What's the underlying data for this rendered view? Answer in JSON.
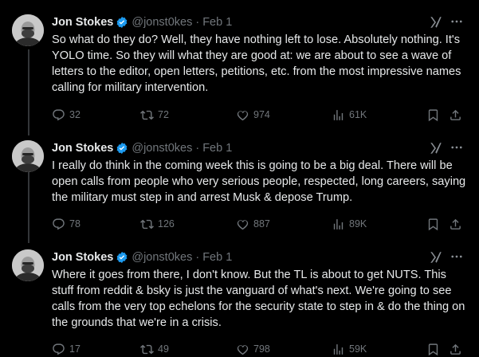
{
  "tweets": [
    {
      "author_name": "Jon Stokes",
      "handle": "@jonst0kes",
      "date": "Feb 1",
      "text": "So what do they do? Well, they have nothing left to lose. Absolutely nothing. It's YOLO time. So they will what they are good at: we are about to see a wave of letters to the editor, open letters, petitions, etc. from the most impressive names calling for military intervention.",
      "replies": "32",
      "reposts": "72",
      "likes": "974",
      "views": "61K"
    },
    {
      "author_name": "Jon Stokes",
      "handle": "@jonst0kes",
      "date": "Feb 1",
      "text": "I really do think in the coming week this is going to be a big deal. There will be open calls from people who very serious people, respected, long careers, saying the military must step in and arrest Musk & depose Trump.",
      "replies": "78",
      "reposts": "126",
      "likes": "887",
      "views": "89K"
    },
    {
      "author_name": "Jon Stokes",
      "handle": "@jonst0kes",
      "date": "Feb 1",
      "text": "Where it goes from there, I don't know. But the TL is about to get NUTS. This stuff from reddit & bsky is just the vanguard of what's next. We're going to see calls from the very top echelons for the security state to step in & do the thing on the grounds that we're in a crisis.",
      "replies": "17",
      "reposts": "49",
      "likes": "798",
      "views": "59K"
    }
  ],
  "separator": "·",
  "icons": {
    "verified": "verified-badge-icon",
    "grok": "grok-icon",
    "more": "more-dots-icon",
    "reply": "reply-icon",
    "repost": "repost-icon",
    "like": "like-icon",
    "views": "views-icon",
    "bookmark": "bookmark-icon",
    "share": "share-icon"
  },
  "colors": {
    "background": "#000000",
    "text": "#e7e9ea",
    "muted": "#71767b",
    "verified": "#1d9bf0",
    "thread_line": "#333639"
  }
}
